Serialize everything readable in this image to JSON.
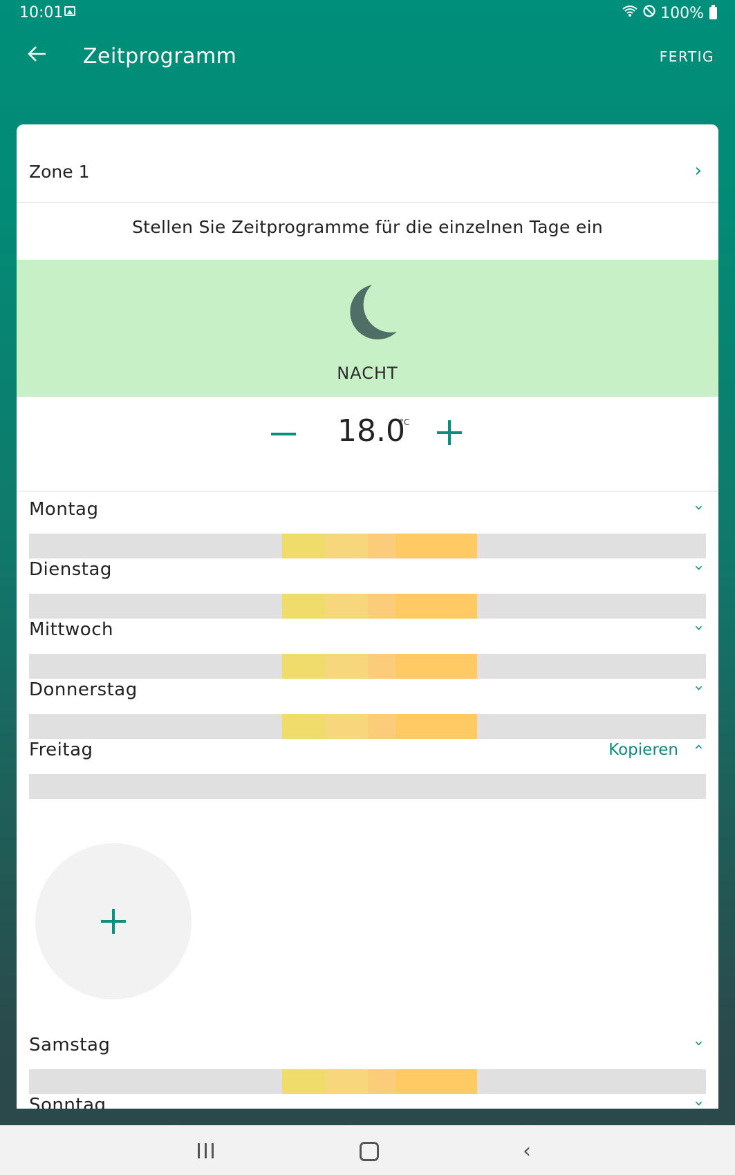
{
  "status_bar": {
    "time": "10:01",
    "battery": "100%"
  },
  "app_bar": {
    "title": "Zeitprogramm",
    "done_label": "FERTIG"
  },
  "zone": {
    "label": "Zone 1"
  },
  "instruction": "Stellen Sie Zeitprogramme für die einzelnen Tage ein",
  "mode": {
    "label": "NACHT",
    "icon": "moon-icon",
    "color": "#c8f0c6"
  },
  "temperature": {
    "value": "18.0",
    "unit": "°C"
  },
  "days": [
    {
      "name": "Montag"
    },
    {
      "name": "Dienstag"
    },
    {
      "name": "Mittwoch"
    },
    {
      "name": "Donnerstag"
    },
    {
      "name": "Freitag",
      "action": "Kopieren"
    },
    {
      "name": "Samstag"
    },
    {
      "name": "Sonntag"
    }
  ],
  "colors": {
    "accent": "#0a8f7e",
    "header": "#008f7a"
  }
}
